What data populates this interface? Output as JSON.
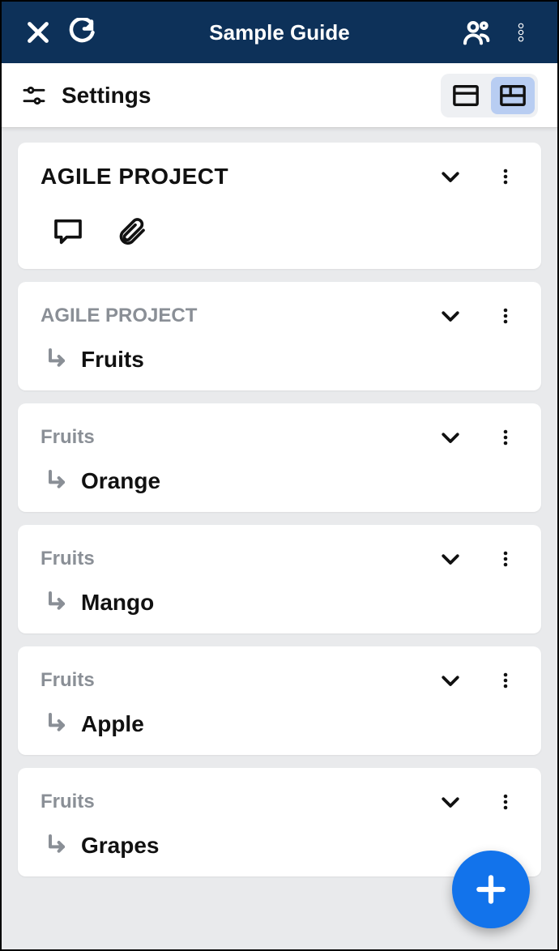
{
  "header": {
    "title": "Sample Guide"
  },
  "settings": {
    "label": "Settings"
  },
  "cards": [
    {
      "title": "AGILE PROJECT"
    },
    {
      "parent": "AGILE PROJECT",
      "child": "Fruits"
    },
    {
      "parent": "Fruits",
      "child": "Orange"
    },
    {
      "parent": "Fruits",
      "child": "Mango"
    },
    {
      "parent": "Fruits",
      "child": "Apple"
    },
    {
      "parent": "Fruits",
      "child": "Grapes"
    }
  ]
}
